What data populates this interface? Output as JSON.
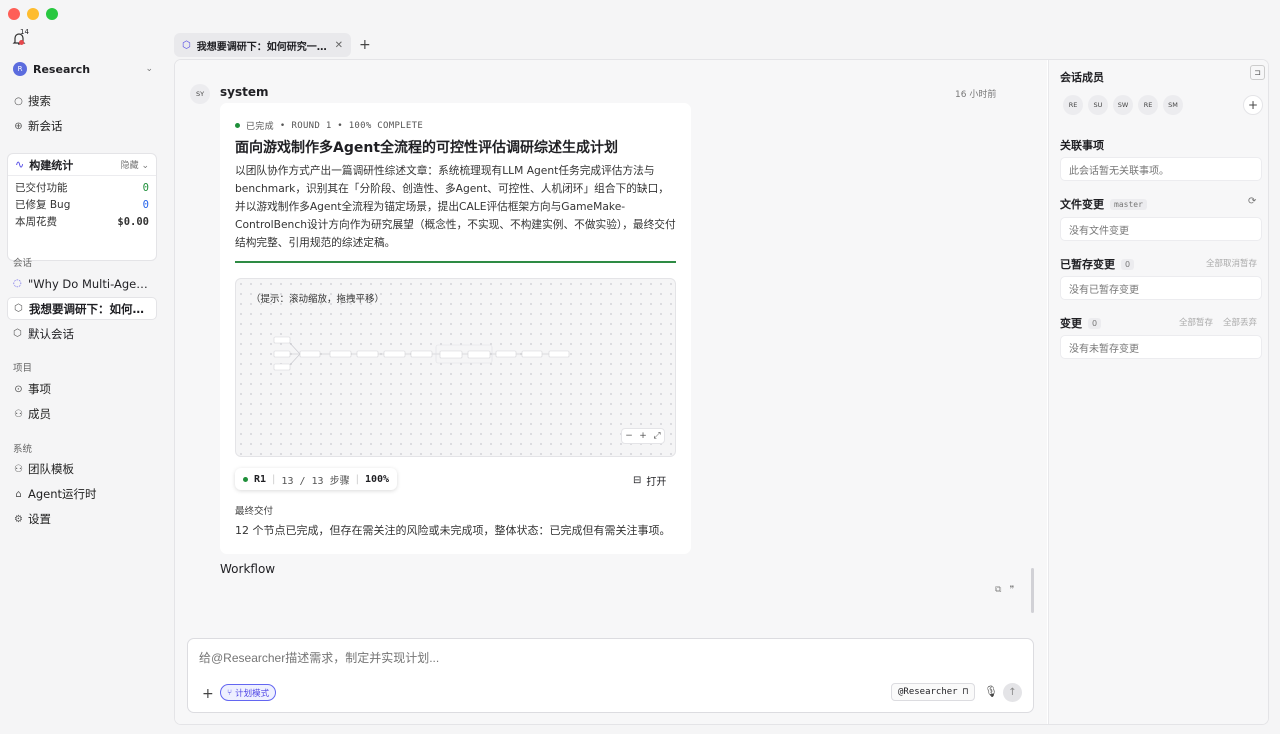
{
  "sidebar": {
    "notification_count": "14",
    "workspace": {
      "avatar": "R",
      "name": "Research"
    },
    "search": "搜索",
    "new_chat": "新会话",
    "stats": {
      "title": "构建统计",
      "hide_label": "隐藏",
      "rows": [
        {
          "label": "已交付功能",
          "value": "0"
        },
        {
          "label": "已修复 Bug",
          "value": "0"
        },
        {
          "label": "本周花费",
          "value": "$0.00"
        }
      ]
    },
    "sessions_header": "会话",
    "sessions": [
      {
        "label": "\"Why Do Multi-Agent ..."
      },
      {
        "label": "我想要调研下：如何研..."
      },
      {
        "label": "默认会话"
      }
    ],
    "projects_header": "项目",
    "projects": [
      {
        "label": "事项"
      },
      {
        "label": "成员"
      }
    ],
    "system_header": "系统",
    "system": [
      {
        "label": "团队模板"
      },
      {
        "label": "Agent运行时"
      },
      {
        "label": "设置"
      }
    ]
  },
  "tab": {
    "label": "我想要调研下：如何研究一种评..."
  },
  "message": {
    "avatar": "SY",
    "author": "system",
    "time": "16 小时前",
    "card": {
      "status": "已完成",
      "round": "ROUND 1 • 100% COMPLETE",
      "title": "面向游戏制作多Agent全流程的可控性评估调研综述生成计划",
      "description": "以团队协作方式产出一篇调研性综述文章：系统梳理现有LLM Agent任务完成评估方法与benchmark，识别其在「分阶段、创造性、多Agent、可控性、人机闭环」组合下的缺口，并以游戏制作多Agent全流程为锚定场景，提出CALE评估框架方向与GameMake-ControlBench设计方向作为研究展望（概念性，不实现、不构建实例、不做实验），最终交付结构完整、引用规范的综述定稿。",
      "hint": "（提示：滚动缩放，拖拽平移）",
      "round_badge": "R1",
      "steps": "13 / 13 步骤",
      "percent": "100%",
      "open_label": "打开",
      "final_label": "最终交付",
      "final_text": "12 个节点已完成，但存在需关注的风险或未完成项，整体状态：已完成但有需关注事项。"
    },
    "footer": "Workflow"
  },
  "composer": {
    "placeholder": "给@Researcher描述需求，制定并实现计划...",
    "plan_mode": "计划模式",
    "agent": "@Researcher"
  },
  "right_panel": {
    "members_title": "会话成员",
    "members": [
      "RE",
      "SU",
      "SW",
      "RE",
      "SM"
    ],
    "related_title": "关联事项",
    "related_empty": "此会话暂无关联事项。",
    "files_title": "文件变更",
    "branch": "master",
    "files_empty": "没有文件变更",
    "staged_title": "已暂存变更",
    "staged_count": "0",
    "unstage_all": "全部取消暂存",
    "staged_empty": "没有已暂存变更",
    "changes_title": "变更",
    "changes_count": "0",
    "stage_all": "全部暂存",
    "discard_all": "全部丢弃",
    "changes_empty": "没有未暂存变更"
  },
  "colors": {
    "accent": "#4f46e5",
    "success": "#1f8f3a",
    "danger": "#e5484d"
  }
}
